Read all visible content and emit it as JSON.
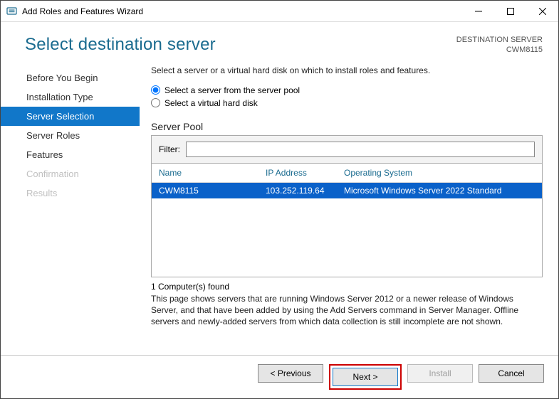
{
  "window": {
    "title": "Add Roles and Features Wizard"
  },
  "header": {
    "page_title": "Select destination server",
    "dest_label": "DESTINATION SERVER",
    "dest_value": "CWM8115"
  },
  "sidebar": {
    "items": [
      {
        "label": "Before You Begin",
        "state": "normal"
      },
      {
        "label": "Installation Type",
        "state": "normal"
      },
      {
        "label": "Server Selection",
        "state": "selected"
      },
      {
        "label": "Server Roles",
        "state": "normal"
      },
      {
        "label": "Features",
        "state": "normal"
      },
      {
        "label": "Confirmation",
        "state": "disabled"
      },
      {
        "label": "Results",
        "state": "disabled"
      }
    ]
  },
  "content": {
    "instruction": "Select a server or a virtual hard disk on which to install roles and features.",
    "radio_pool": "Select a server from the server pool",
    "radio_vhd": "Select a virtual hard disk",
    "section_heading": "Server Pool",
    "filter_label": "Filter:",
    "filter_value": "",
    "columns": {
      "name": "Name",
      "ip": "IP Address",
      "os": "Operating System"
    },
    "rows": [
      {
        "name": "CWM8115",
        "ip": "103.252.119.64",
        "os": "Microsoft Windows Server 2022 Standard",
        "selected": true
      }
    ],
    "count_text": "1 Computer(s) found",
    "help_text": "This page shows servers that are running Windows Server 2012 or a newer release of Windows Server, and that have been added by using the Add Servers command in Server Manager. Offline servers and newly-added servers from which data collection is still incomplete are not shown."
  },
  "footer": {
    "previous": "< Previous",
    "next": "Next >",
    "install": "Install",
    "cancel": "Cancel"
  }
}
